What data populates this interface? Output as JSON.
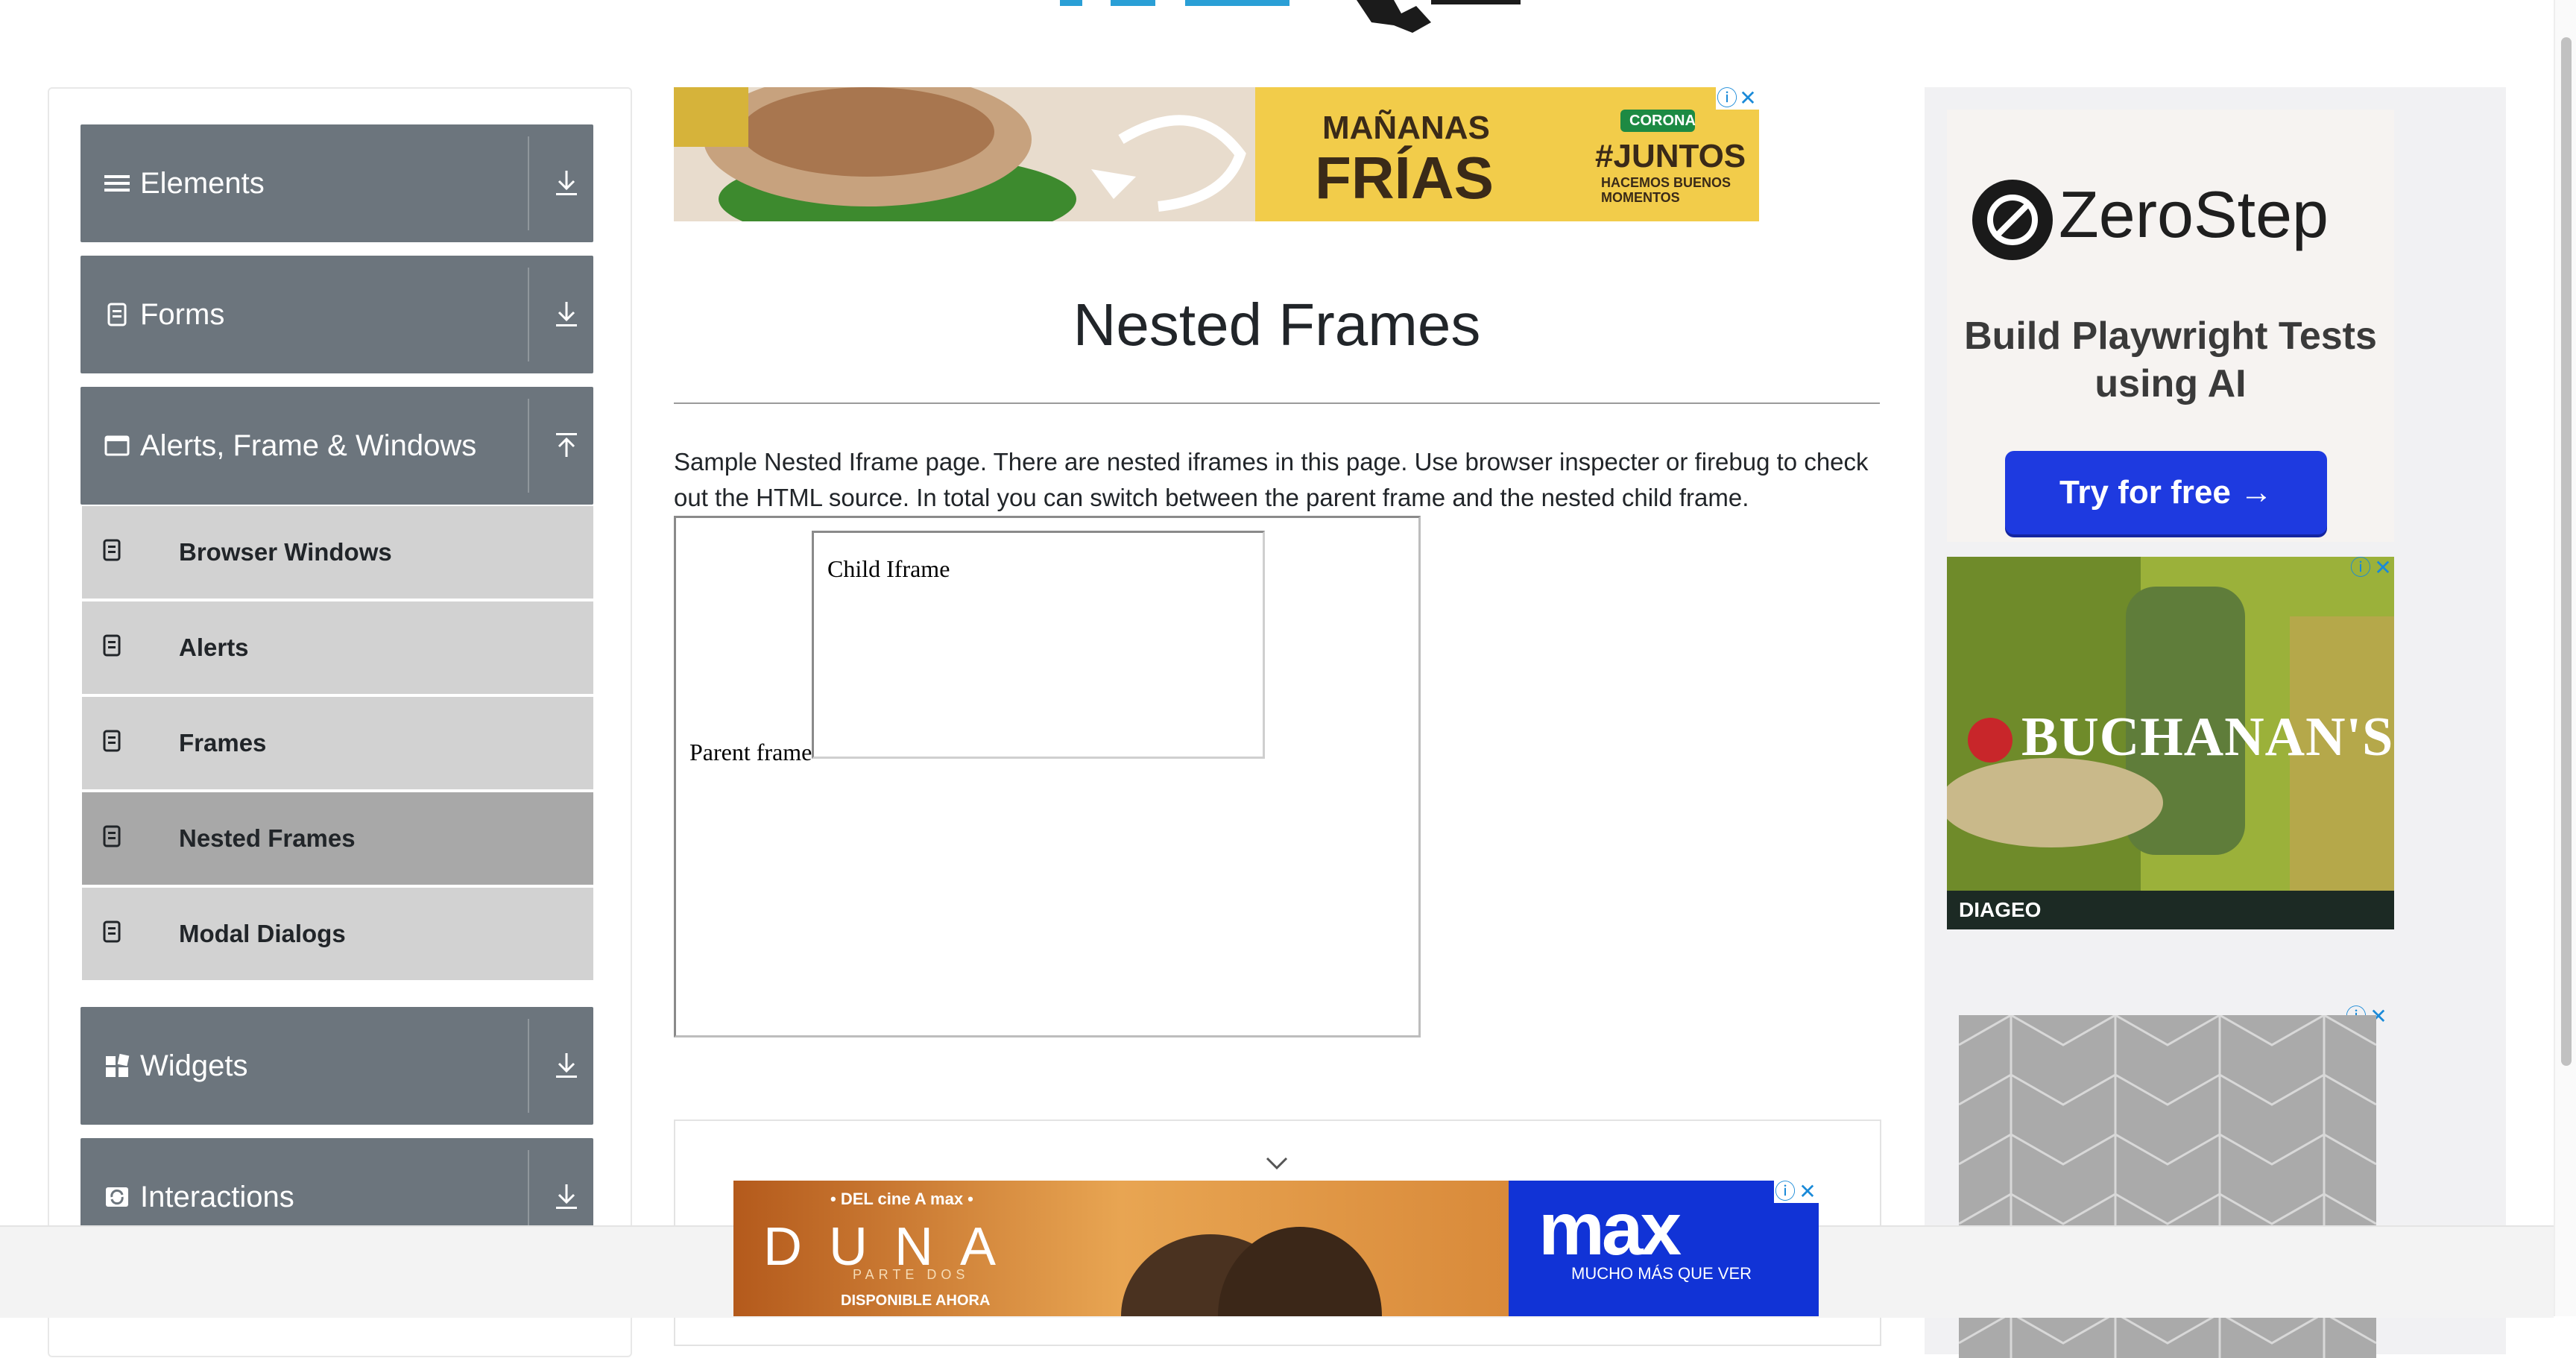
{
  "sidebar": {
    "groups": [
      {
        "label": "Elements",
        "icon": "list-icon",
        "expanded": false
      },
      {
        "label": "Forms",
        "icon": "form-icon",
        "expanded": false
      },
      {
        "label": "Alerts, Frame & Windows",
        "icon": "window-icon",
        "expanded": true
      },
      {
        "label": "Widgets",
        "icon": "widgets-icon",
        "expanded": false
      },
      {
        "label": "Interactions",
        "icon": "interactions-icon",
        "expanded": false
      }
    ],
    "alerts_items": [
      {
        "label": "Browser Windows"
      },
      {
        "label": "Alerts"
      },
      {
        "label": "Frames"
      },
      {
        "label": "Nested Frames",
        "active": true
      },
      {
        "label": "Modal Dialogs"
      }
    ]
  },
  "main": {
    "title": "Nested Frames",
    "description": "Sample Nested Iframe page. There are nested iframes in this page. Use browser inspecter or firebug to check out the HTML source. In total you can switch between the parent frame and the nested child frame.",
    "parent_frame_label": "Parent frame",
    "child_frame_label": "Child Iframe"
  },
  "ads": {
    "top_banner": {
      "line1": "MAÑANAS",
      "line2": "FRÍAS",
      "badge": "CORONA",
      "hashtag": "#JUNTOS",
      "tagline": "HACEMOS BUENOS MOMENTOS"
    },
    "zerostep": {
      "brand": "ZeroStep",
      "tagline": "Build Playwright Tests using AI",
      "cta": "Try for free →"
    },
    "buchanans": {
      "brand": "BUCHANAN'S",
      "maker": "DIAGEO"
    },
    "bottom_banner": {
      "top": "• DEL cine A max •",
      "title": "DUNA",
      "subtitle": "PARTE DOS",
      "cta": "DISPONIBLE AHORA",
      "brand": "max",
      "brand_tag": "MUCHO MÁS QUE VER"
    }
  },
  "colors": {
    "group_bg": "#6c757d",
    "sub_item_bg": "#d2d2d2",
    "sub_item_active_bg": "#a8a8a8",
    "zerostep_button": "#1e3ae0",
    "max_blue": "#1133d6"
  }
}
